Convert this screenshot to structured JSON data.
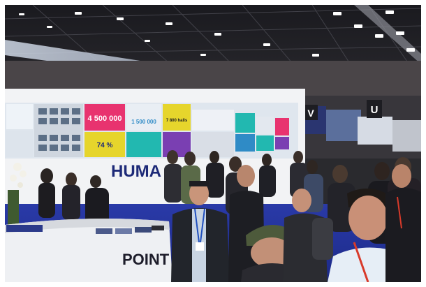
{
  "scene": {
    "description_free": true,
    "colors": {
      "ceiling": "#1d1d22",
      "wall": "#3b3a3d",
      "booth_white": "#f2f3f5",
      "brand_navy": "#1e2a78",
      "carpet_blue": "#2436a8",
      "panel_pink": "#e8336f",
      "panel_yellow": "#e6d52c",
      "panel_teal": "#22b8b0",
      "panel_purple": "#7a3fb2"
    }
  },
  "screens": {
    "stat_1": "4 500 000",
    "stat_2": "1 500 000",
    "stat_3": "7 800 halls",
    "stat_4": "74 %"
  },
  "booth": {
    "brand_partial": "HUMA",
    "counter_text": "POINT"
  },
  "signs": {
    "hall_letter_v": "V",
    "hall_letter_u": "U"
  }
}
